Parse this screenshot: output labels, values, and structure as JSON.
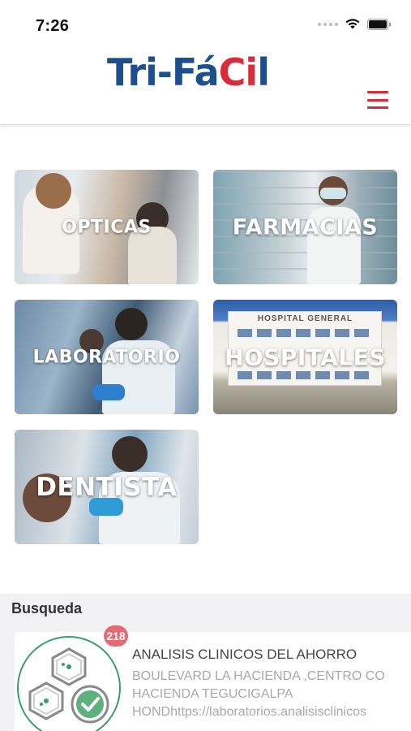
{
  "status_bar": {
    "time": "7:26",
    "icons": [
      "signal-dots-icon",
      "wifi-icon",
      "battery-icon"
    ]
  },
  "header": {
    "logo": {
      "part_blue_1": "Tri-",
      "part_blue_2": "Fá",
      "part_red": "Ci",
      "part_blue_3": "l"
    },
    "menu_icon": "hamburger-menu-icon",
    "colors": {
      "brand_blue": "#1d4f8f",
      "brand_red": "#d92b3a"
    }
  },
  "categories": [
    {
      "label": "OPTICAS"
    },
    {
      "label": "FARMACIAS"
    },
    {
      "label": "LABORATORIO"
    },
    {
      "label": "HOSPITALES",
      "sign_text": "HOSPITAL GENERAL"
    },
    {
      "label": "DENTISTA"
    }
  ],
  "search": {
    "title": "Busqueda",
    "results": [
      {
        "badge": "218",
        "name": "ANALISIS CLINICOS DEL AHORRO",
        "address_lines": [
          "BOULEVARD LA HACIENDA ,CENTRO CO",
          "HACIENDA TEGUCIGALPA",
          "HONDhttps://laboratorios.analisisclinicos"
        ],
        "logo_icon": "hexagon-molecule-check-icon"
      }
    ]
  }
}
